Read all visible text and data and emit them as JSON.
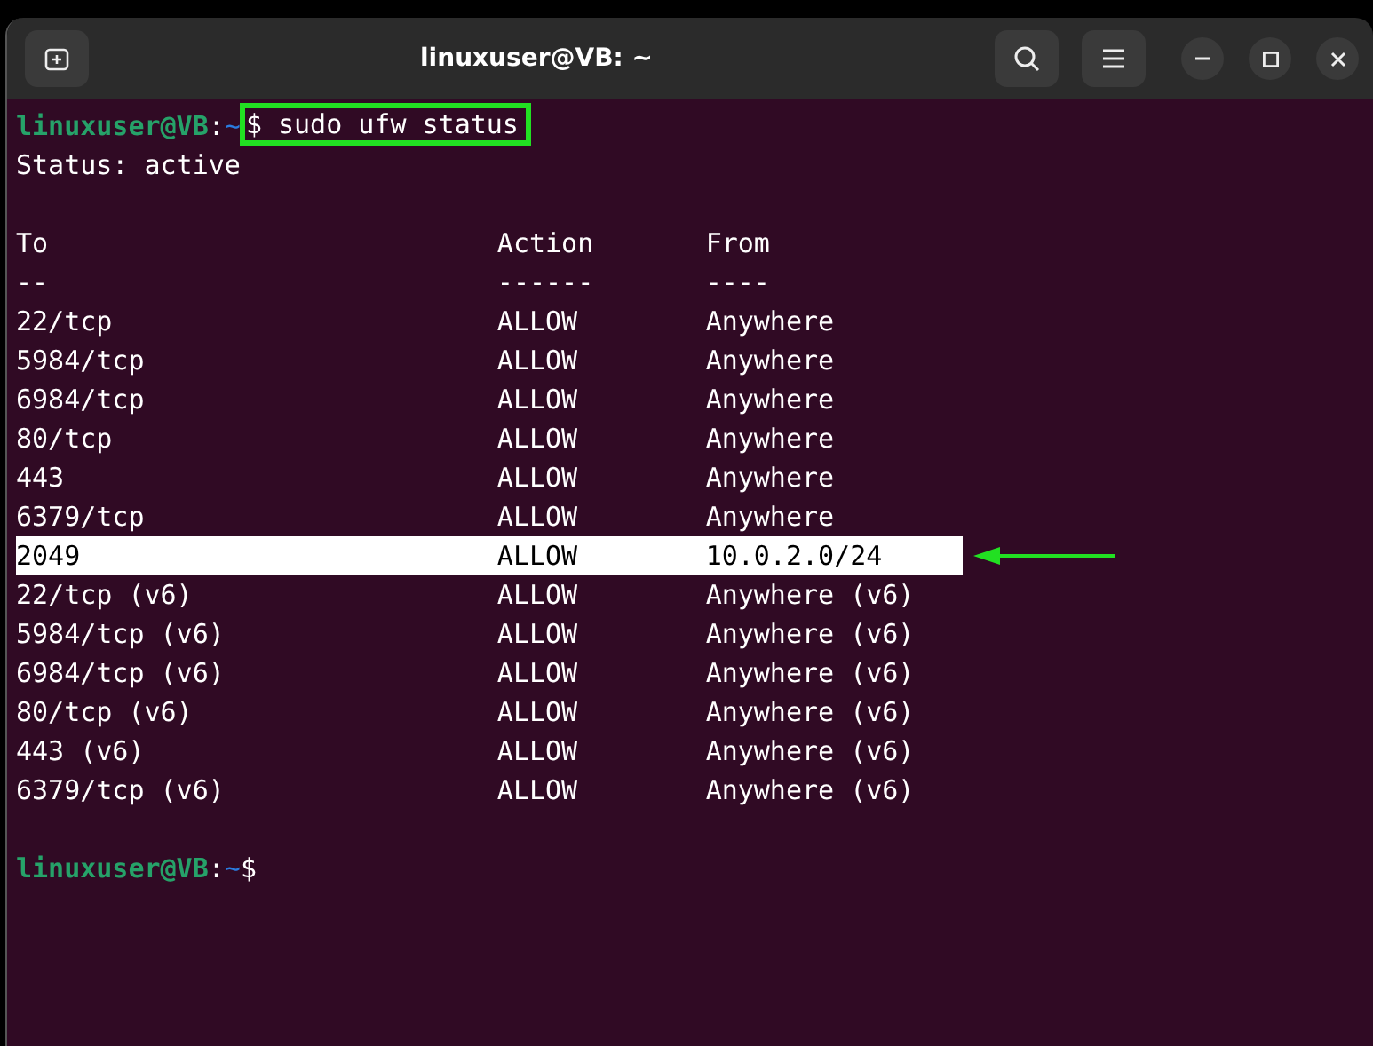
{
  "window": {
    "title": "linuxuser@VB: ~"
  },
  "terminal": {
    "prompt": {
      "user_host": "linuxuser@VB",
      "separator": ":",
      "path": "~",
      "symbol": "$"
    },
    "command": {
      "text": "sudo ufw status",
      "highlighted": true
    },
    "status_line": "Status: active",
    "table": {
      "columns": [
        "To",
        "Action",
        "From"
      ],
      "rule": [
        "--",
        "------",
        "----"
      ],
      "rows": [
        {
          "cells": [
            "22/tcp",
            "ALLOW",
            "Anywhere"
          ],
          "highlighted": false
        },
        {
          "cells": [
            "5984/tcp",
            "ALLOW",
            "Anywhere"
          ],
          "highlighted": false
        },
        {
          "cells": [
            "6984/tcp",
            "ALLOW",
            "Anywhere"
          ],
          "highlighted": false
        },
        {
          "cells": [
            "80/tcp",
            "ALLOW",
            "Anywhere"
          ],
          "highlighted": false
        },
        {
          "cells": [
            "443",
            "ALLOW",
            "Anywhere"
          ],
          "highlighted": false
        },
        {
          "cells": [
            "6379/tcp",
            "ALLOW",
            "Anywhere"
          ],
          "highlighted": false
        },
        {
          "cells": [
            "2049",
            "ALLOW",
            "10.0.2.0/24"
          ],
          "highlighted": true
        },
        {
          "cells": [
            "22/tcp (v6)",
            "ALLOW",
            "Anywhere (v6)"
          ],
          "highlighted": false
        },
        {
          "cells": [
            "5984/tcp (v6)",
            "ALLOW",
            "Anywhere (v6)"
          ],
          "highlighted": false
        },
        {
          "cells": [
            "6984/tcp (v6)",
            "ALLOW",
            "Anywhere (v6)"
          ],
          "highlighted": false
        },
        {
          "cells": [
            "80/tcp (v6)",
            "ALLOW",
            "Anywhere (v6)"
          ],
          "highlighted": false
        },
        {
          "cells": [
            "443 (v6)",
            "ALLOW",
            "Anywhere (v6)"
          ],
          "highlighted": false
        },
        {
          "cells": [
            "6379/tcp (v6)",
            "ALLOW",
            "Anywhere (v6)"
          ],
          "highlighted": false
        }
      ]
    },
    "final_prompt": {
      "user_host": "linuxuser@VB",
      "separator": ":",
      "path": "~",
      "symbol": "$"
    }
  }
}
